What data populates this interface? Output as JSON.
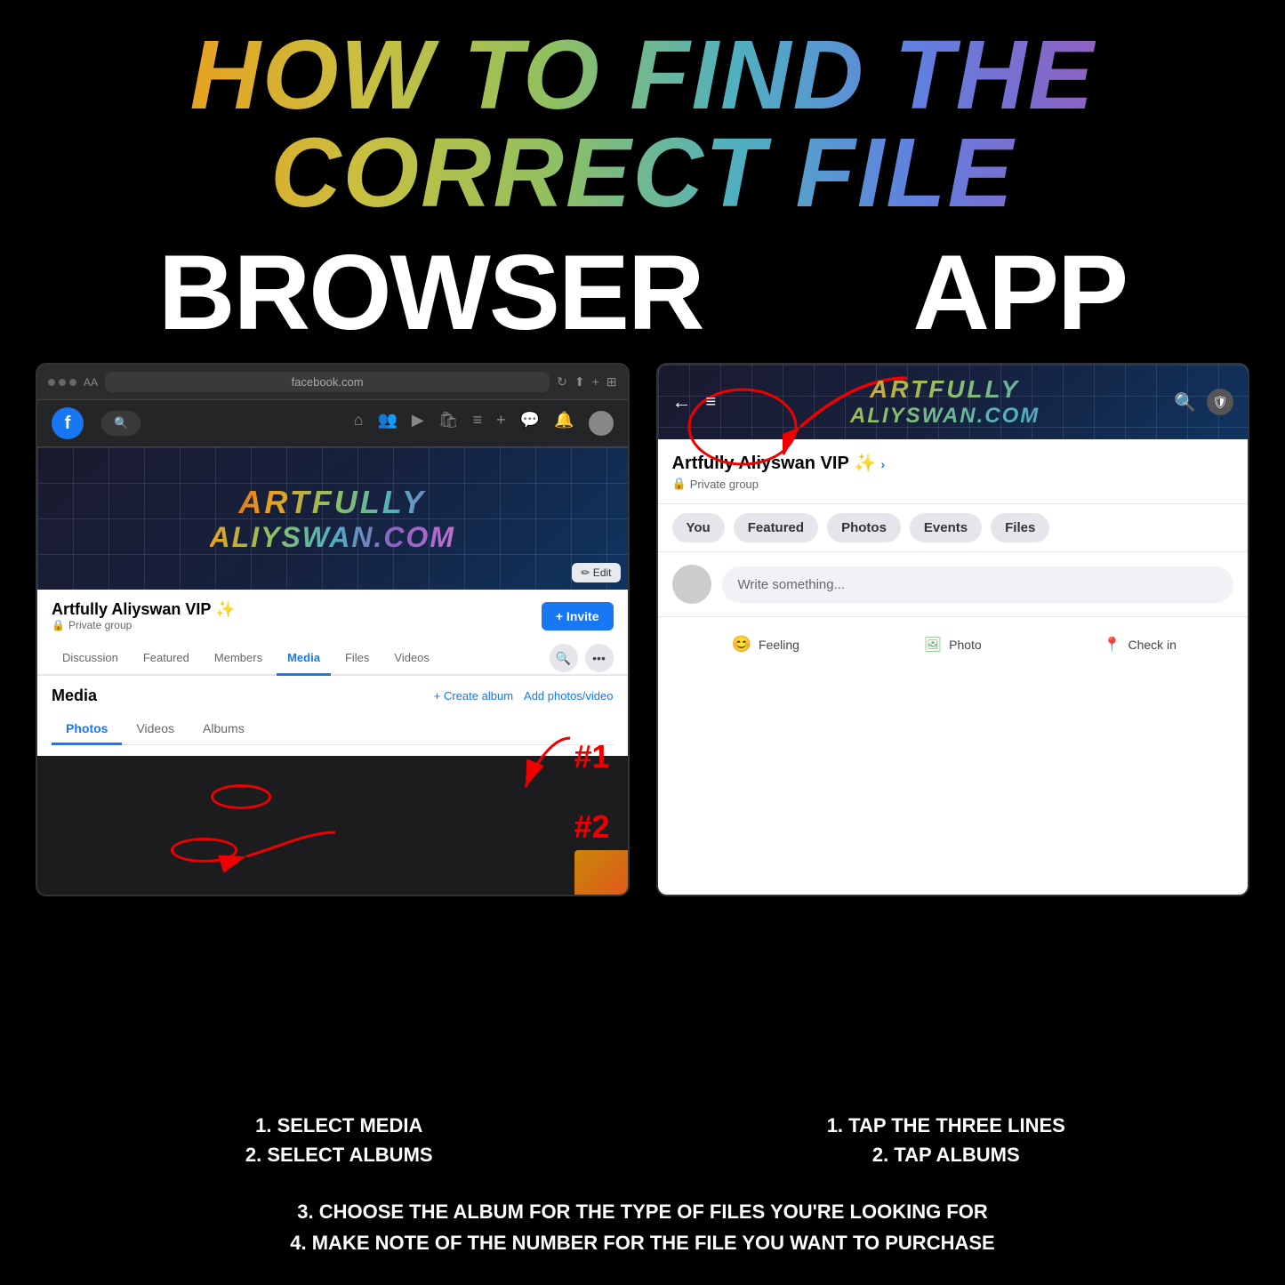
{
  "title": "HOW TO FIND THE CORRECT FILE",
  "section_browser": "BROWSER",
  "section_app": "APP",
  "browser": {
    "url": "facebook.com",
    "group_name": "Artfully Aliyswan VIP ✨",
    "group_type": "Private group",
    "tabs": [
      "Discussion",
      "Featured",
      "Members",
      "Media",
      "Files",
      "Videos"
    ],
    "active_tab": "Media",
    "media_title": "Media",
    "media_actions": [
      "+ Create album",
      "Add photos/video"
    ],
    "media_tabs": [
      "Photos",
      "Videos",
      "Albums"
    ],
    "active_media_tab": "Photos",
    "annotation1": "#1",
    "annotation2": "#2",
    "edit_label": "✏ Edit",
    "artfully_line1": "ARTFULLY",
    "artfully_line2": "ALIYSWAN.COM"
  },
  "app": {
    "group_name": "Artfully Aliyswan VIP ✨",
    "group_name_suffix": " >",
    "group_type": "Private group",
    "tabs": [
      "You",
      "Featured",
      "Photos",
      "Events",
      "Files"
    ],
    "write_placeholder": "Write something...",
    "action_feeling": "Feeling",
    "action_photo": "Photo",
    "action_checkin": "Check in",
    "artfully_line1": "ARTFULLY",
    "artfully_line2": "ALIYSWAN.COM"
  },
  "instructions": {
    "browser_col": {
      "line1": "1. SELECT MEDIA",
      "line2": "2. SELECT ALBUMS"
    },
    "app_col": {
      "line1": "1. TAP THE THREE LINES",
      "line2": "2. TAP ALBUMS"
    },
    "bottom": {
      "line1": "3. CHOOSE THE ALBUM FOR THE TYPE OF FILES YOU'RE LOOKING FOR",
      "line2": "4. MAKE NOTE OF THE NUMBER FOR THE FILE YOU WANT TO PURCHASE"
    }
  }
}
